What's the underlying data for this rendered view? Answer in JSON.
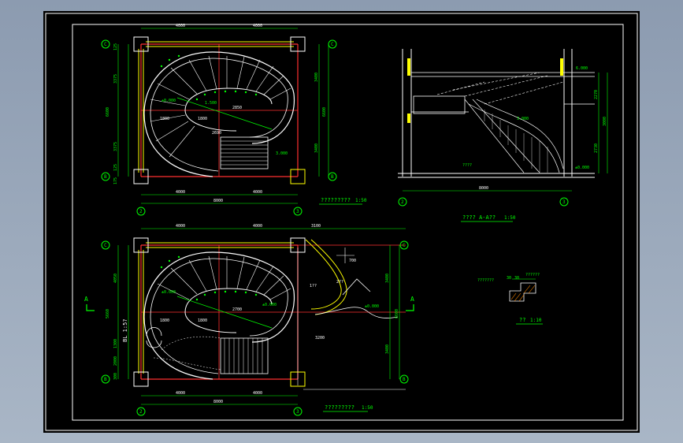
{
  "plan1": {
    "dims_top": [
      "4000",
      "4000"
    ],
    "dims_bottom_inner": [
      "4000",
      "4000"
    ],
    "dims_bottom_total": "8000",
    "dims_left": [
      "125",
      "3375",
      "6600",
      "3375",
      "125",
      "175"
    ],
    "dims_right": [
      "3400",
      "6600",
      "3400"
    ],
    "inner_dims": [
      "1800",
      "1800",
      "2850",
      "2690"
    ],
    "axes_left": [
      "C",
      "B"
    ],
    "axes_right": [
      "C",
      "B"
    ],
    "axes_bottom": [
      "2",
      "3"
    ],
    "levels": [
      "±0.000",
      "3.000",
      "1.500"
    ],
    "title": "?????????",
    "scale": "1:50"
  },
  "section": {
    "dims_bottom": "8000",
    "dims_right": [
      "2270",
      "3000",
      "2730"
    ],
    "levels": [
      "6.000",
      "3.000",
      "±0.000",
      "????"
    ],
    "axes_bottom": [
      "2",
      "3"
    ],
    "title": "???? A-A??",
    "scale": "1:50"
  },
  "plan2": {
    "dims_top": [
      "4000",
      "4000",
      "3100"
    ],
    "dims_bottom_inner": [
      "4000",
      "4000"
    ],
    "dims_bottom_total": "8000",
    "dims_left": [
      "4050",
      "5660",
      "1300",
      "2000",
      "300"
    ],
    "dims_right": [
      "3400",
      "6600",
      "3400"
    ],
    "inner_dims": [
      "1800",
      "1800",
      "2700",
      "3200",
      "700"
    ],
    "axes_left": [
      "C",
      "B"
    ],
    "axes_right": [
      "C",
      "B"
    ],
    "axes_bottom": [
      "2",
      "3"
    ],
    "section_marks": [
      "A",
      "A"
    ],
    "levels": [
      "±0.000",
      "±0.000",
      "±0.000"
    ],
    "room_labels": [
      "1??",
      "2??",
      "BL 1:5?"
    ],
    "title": "?????????",
    "scale": "1:50"
  },
  "detail": {
    "labels": [
      "???????",
      "30",
      "30",
      "??????"
    ],
    "title": "??",
    "scale": "1:10"
  }
}
